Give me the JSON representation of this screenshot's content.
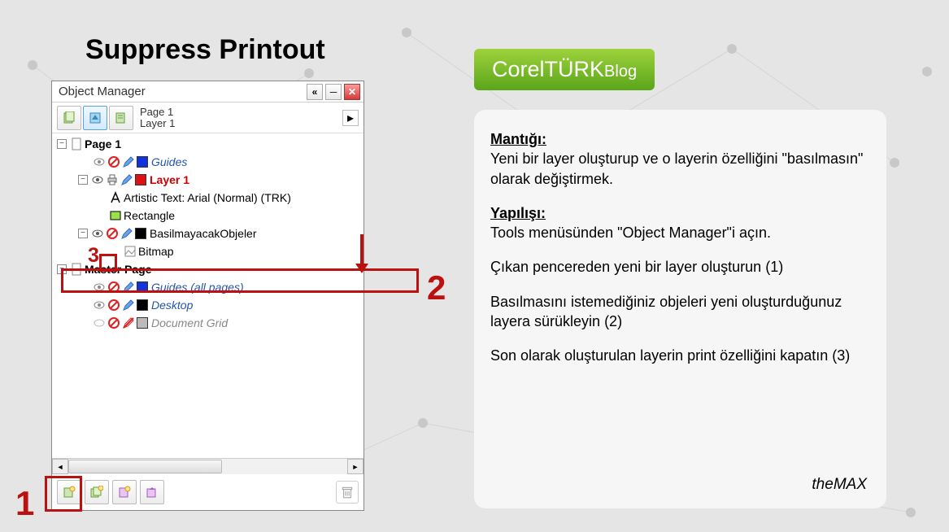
{
  "title": "Suppress Printout",
  "panel": {
    "title": "Object Manager",
    "collapse_glyph": "«",
    "page_label": "Page 1",
    "layer_label": "Layer 1"
  },
  "tree": {
    "page1": "Page 1",
    "guides": "Guides",
    "layer1": "Layer 1",
    "artistic_text": "Artistic Text: Arial (Normal) (TRK)",
    "rectangle": "Rectangle",
    "noprint_layer": "BasilmayacakObjeler",
    "bitmap": "Bitmap",
    "master_page": "Master Page",
    "guides_all": "Guides (all pages)",
    "desktop": "Desktop",
    "doc_grid": "Document Grid"
  },
  "callouts": {
    "one": "1",
    "two": "2",
    "three": "3"
  },
  "brand": {
    "main": "CorelTÜRK",
    "sub": "Blog"
  },
  "text": {
    "h1": "Mantığı:",
    "p1": "Yeni bir layer oluşturup ve o layerin özelliğini \"basılmasın\" olarak değiştirmek.",
    "h2": "Yapılışı:",
    "p2": "Tools menüsünden \"Object Manager\"i açın.",
    "p3": "Çıkan pencereden yeni bir layer oluşturun (1)",
    "p4": "Basılmasını istemediğiniz objeleri yeni oluşturduğunuz layera sürükleyin (2)",
    "p5": "Son olarak oluşturulan layerin print özelliğini kapatın (3)",
    "sig": "theMAX"
  }
}
